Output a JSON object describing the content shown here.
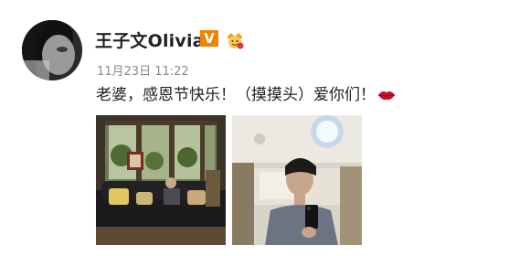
{
  "post": {
    "username": "王子文Olivia",
    "vip_badge": "V",
    "timestamp": "11月23日 11:22",
    "text": "老婆，感恩节快乐！（摸摸头）爱你们！",
    "emoji_icon": "lips-icon",
    "member_icon": "weibo-member-crown-icon",
    "accent_colors": {
      "vip": "#f08300",
      "text": "#222222",
      "meta": "#8a8a8a"
    }
  }
}
